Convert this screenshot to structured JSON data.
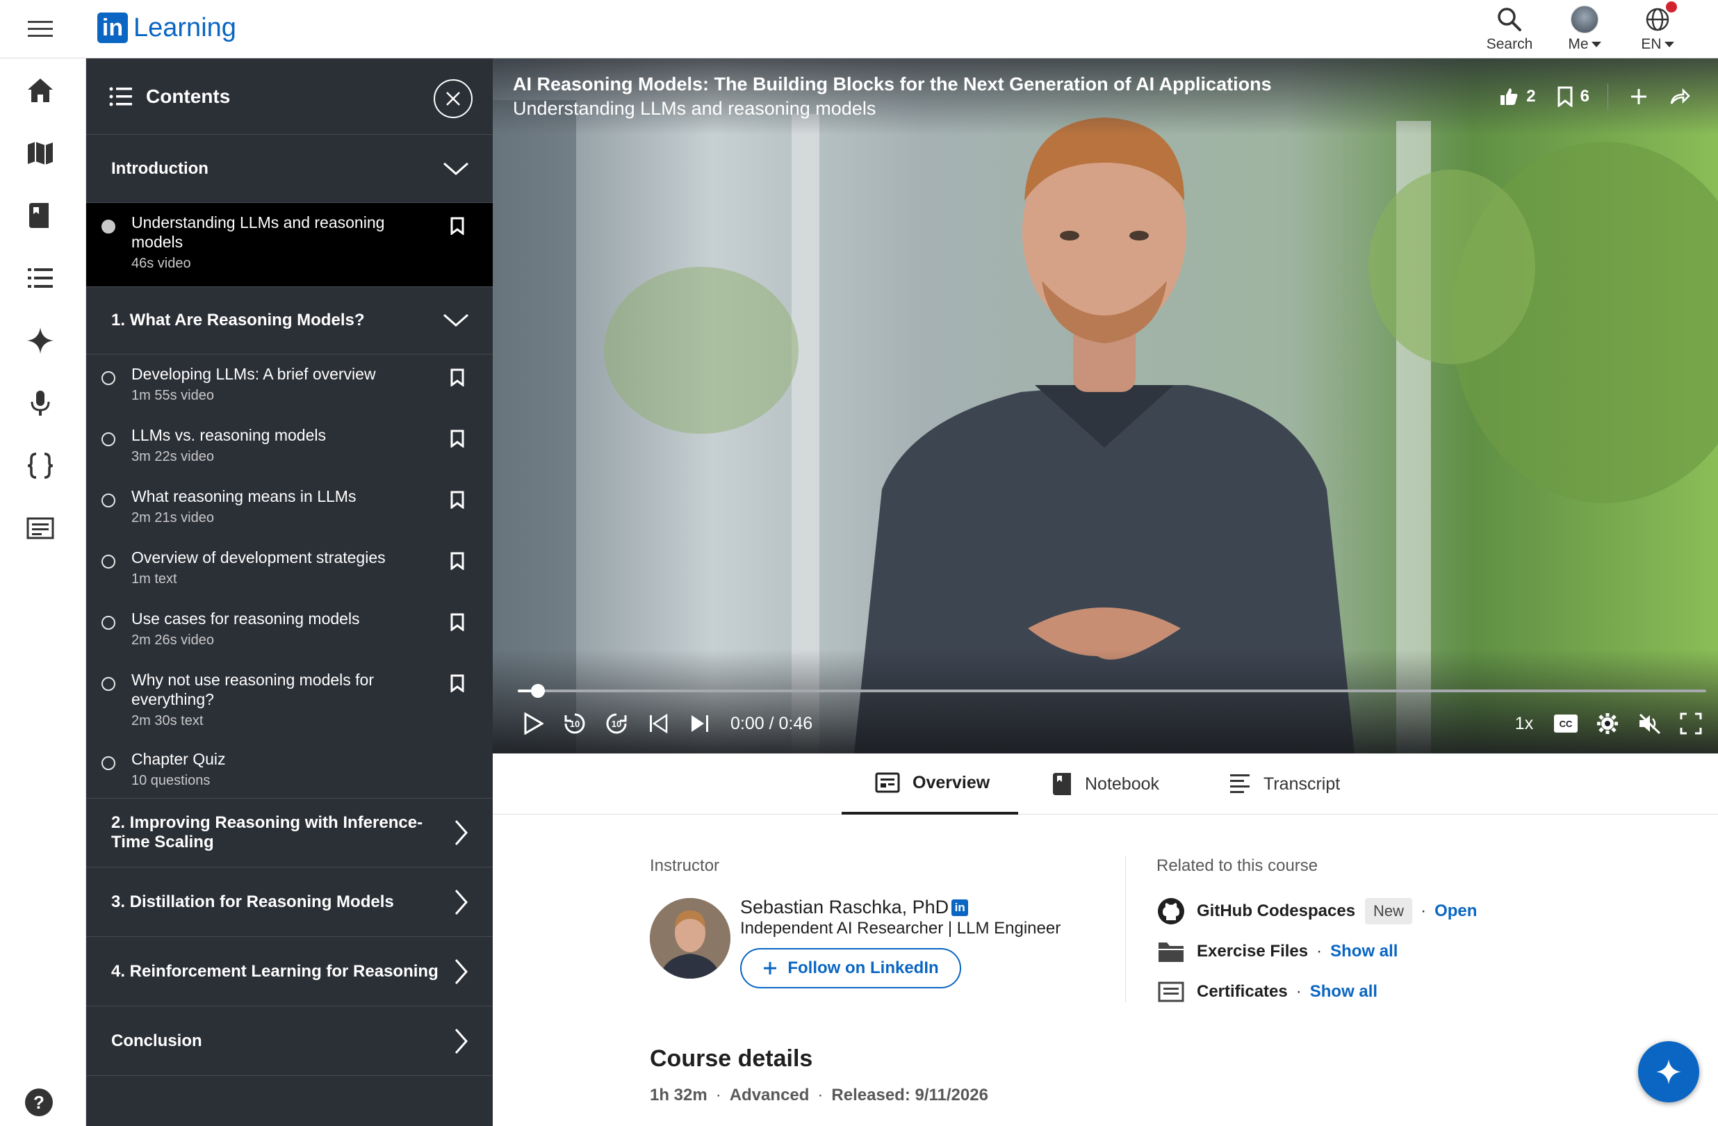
{
  "app": {
    "logo_badge": "in",
    "logo_text": "Learning"
  },
  "top": {
    "search_label": "Search",
    "me_label": "Me",
    "lang_label": "EN"
  },
  "contents": {
    "title": "Contents",
    "sections": [
      {
        "title": "Introduction",
        "expanded": true,
        "items": [
          {
            "title": "Understanding LLMs and reasoning models",
            "meta": "46s video",
            "active": true
          }
        ]
      },
      {
        "title": "1. What Are Reasoning Models?",
        "expanded": true,
        "items": [
          {
            "title": "Developing LLMs: A brief overview",
            "meta": "1m 55s video"
          },
          {
            "title": "LLMs vs. reasoning models",
            "meta": "3m 22s video"
          },
          {
            "title": "What reasoning means in LLMs",
            "meta": "2m 21s video"
          },
          {
            "title": "Overview of development strategies",
            "meta": "1m text"
          },
          {
            "title": "Use cases for reasoning models",
            "meta": "2m 26s video"
          },
          {
            "title": "Why not use reasoning models for everything?",
            "meta": "2m 30s text"
          },
          {
            "title": "Chapter Quiz",
            "meta": "10 questions"
          }
        ]
      },
      {
        "title": "2. Improving Reasoning with Inference-Time Scaling",
        "expanded": false
      },
      {
        "title": "3. Distillation for Reasoning Models",
        "expanded": false
      },
      {
        "title": "4. Reinforcement Learning for Reasoning",
        "expanded": false
      },
      {
        "title": "Conclusion",
        "expanded": false
      }
    ]
  },
  "video": {
    "course_title": "AI Reasoning Models: The Building Blocks for the Next Generation of AI Applications",
    "lesson_title": "Understanding LLMs and reasoning models",
    "likes": "2",
    "saves": "6",
    "timecode": "0:00 / 0:46",
    "speed": "1x",
    "progress_fraction": 0.017
  },
  "tabs": {
    "overview": "Overview",
    "notebook": "Notebook",
    "transcript": "Transcript"
  },
  "overview": {
    "instructor_label": "Instructor",
    "instructor_name": "Sebastian Raschka, PhD",
    "instructor_badge": "in",
    "instructor_role": "Independent AI Researcher | LLM Engineer",
    "follow_label": "Follow on LinkedIn",
    "related_label": "Related to this course",
    "related": [
      {
        "name": "GitHub Codespaces",
        "badge": "New",
        "link": "Open"
      },
      {
        "name": "Exercise Files",
        "link": "Show all"
      },
      {
        "name": "Certificates",
        "link": "Show all"
      }
    ],
    "course_details_title": "Course details",
    "duration": "1h 32m",
    "level": "Advanced",
    "released": "Released: 9/11/2026"
  },
  "colors": {
    "brand": "#0a66c2",
    "panel": "#2b2f36"
  },
  "help_label": "?"
}
